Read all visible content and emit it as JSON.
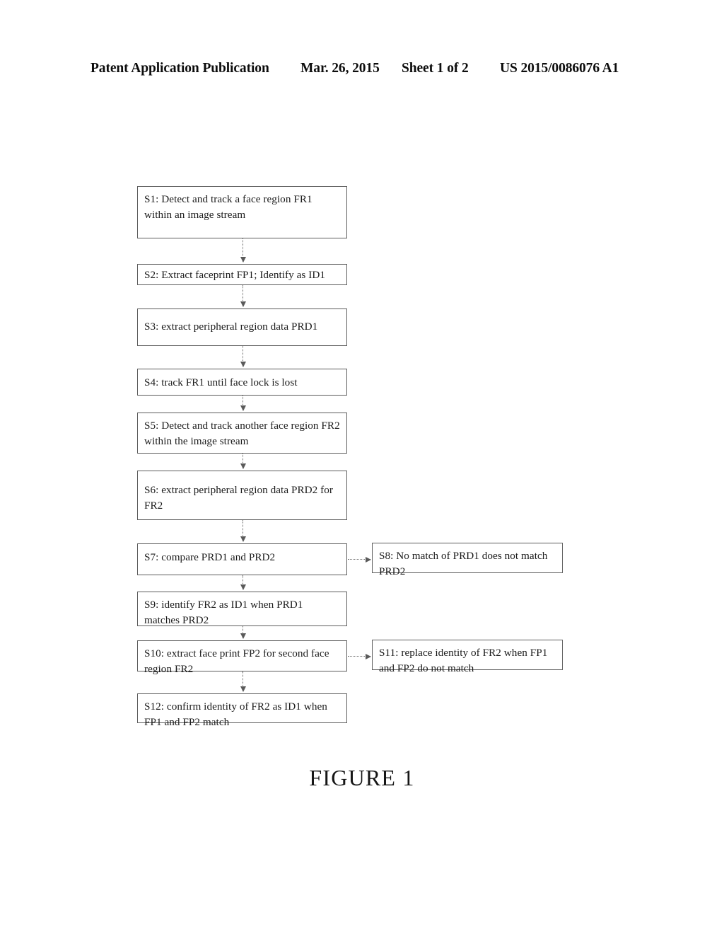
{
  "header": {
    "publication": "Patent Application Publication",
    "date": "Mar. 26, 2015",
    "sheet": "Sheet 1 of 2",
    "doc_number": "US 2015/0086076 A1"
  },
  "figure": {
    "caption": "FIGURE 1",
    "steps": [
      {
        "id": "S1",
        "text": "S1: Detect and track a face region FR1 within an image stream"
      },
      {
        "id": "S2",
        "text": "S2: Extract faceprint FP1; Identify as ID1"
      },
      {
        "id": "S3",
        "text": "S3: extract peripheral region data PRD1"
      },
      {
        "id": "S4",
        "text": "S4: track FR1 until face lock is lost"
      },
      {
        "id": "S5",
        "text": "S5: Detect and track another face region FR2 within the image stream"
      },
      {
        "id": "S6",
        "text": "S6: extract peripheral region data PRD2 for FR2"
      },
      {
        "id": "S7",
        "text": "S7: compare PRD1 and PRD2"
      },
      {
        "id": "S8",
        "text": "S8: No match of PRD1 does not match PRD2"
      },
      {
        "id": "S9",
        "text": "S9: identify FR2 as ID1 when PRD1 matches PRD2"
      },
      {
        "id": "S10",
        "text": "S10: extract face print FP2 for second face region FR2"
      },
      {
        "id": "S11",
        "text": "S11: replace identity of FR2 when FP1 and FP2 do not match"
      },
      {
        "id": "S12",
        "text": "S12: confirm identity of FR2 as ID1 when FP1 and FP2 match"
      }
    ],
    "connectors": [
      {
        "from": "S1",
        "to": "S2",
        "direction": "down"
      },
      {
        "from": "S2",
        "to": "S3",
        "direction": "down"
      },
      {
        "from": "S3",
        "to": "S4",
        "direction": "down"
      },
      {
        "from": "S4",
        "to": "S5",
        "direction": "down"
      },
      {
        "from": "S5",
        "to": "S6",
        "direction": "down"
      },
      {
        "from": "S6",
        "to": "S7",
        "direction": "down"
      },
      {
        "from": "S7",
        "to": "S8",
        "direction": "right"
      },
      {
        "from": "S7",
        "to": "S9",
        "direction": "down"
      },
      {
        "from": "S9",
        "to": "S10",
        "direction": "down"
      },
      {
        "from": "S10",
        "to": "S11",
        "direction": "right"
      },
      {
        "from": "S10",
        "to": "S12",
        "direction": "down"
      }
    ]
  },
  "colors": {
    "page_background": "#ffffff",
    "text": "#1a1a1a",
    "box_border": "#5c5c5c",
    "connector": "#6a6a6a"
  }
}
